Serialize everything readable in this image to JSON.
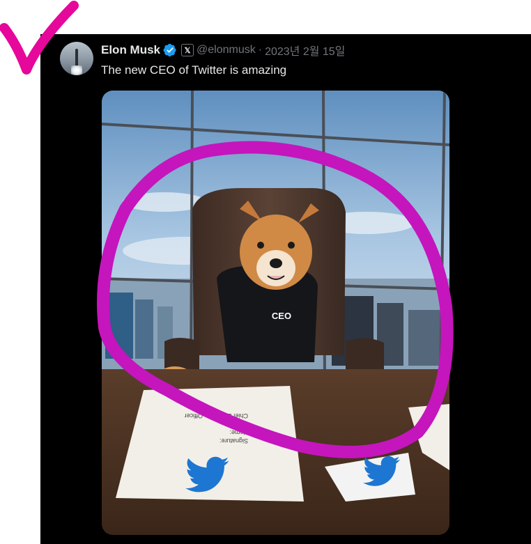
{
  "tweet": {
    "author_name": "Elon Musk",
    "handle": "@elonmusk",
    "separator": "·",
    "date": "2023년 2월 15일",
    "text": "The new CEO of Twitter is amazing",
    "badge_letter": "𝕏"
  },
  "media": {
    "sweater_text": "CEO",
    "paper_text": [
      "Signature:",
      "Name:",
      "Title:",
      "Chief Executive Officer"
    ]
  },
  "icons": [
    "verified-badge-icon",
    "x-affiliate-badge-icon",
    "twitter-bird-icon"
  ],
  "colors": {
    "background": "#000000",
    "text_primary": "#e7e9ea",
    "text_secondary": "#71767b",
    "verified": "#1d9bf0",
    "annotation": "#e6079b"
  }
}
